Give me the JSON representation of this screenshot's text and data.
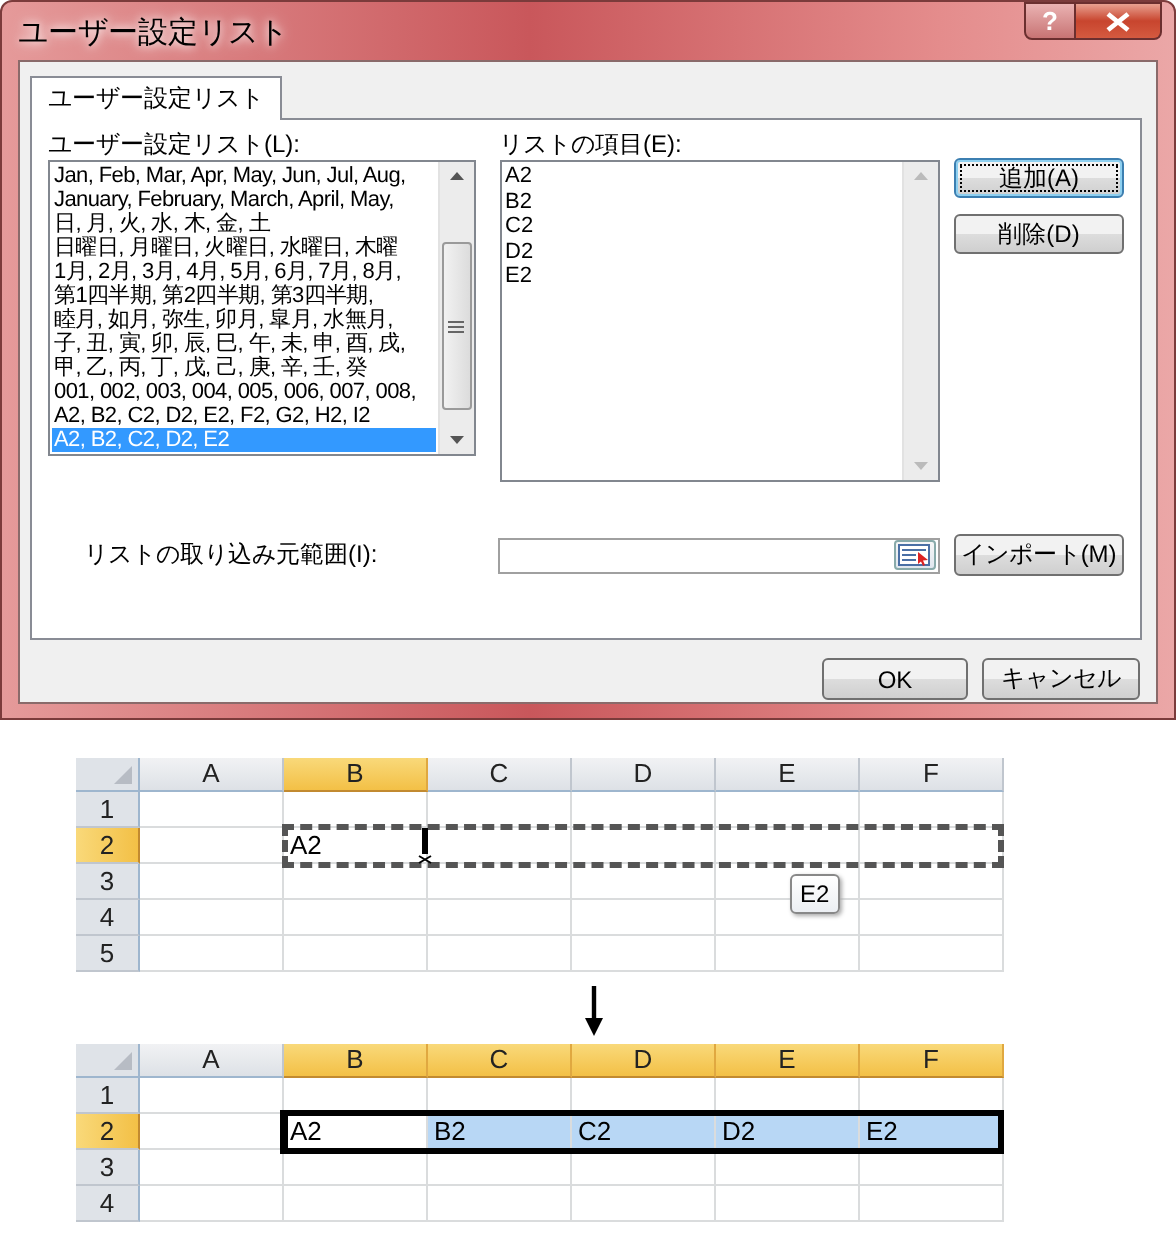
{
  "dialog": {
    "title": "ユーザー設定リスト",
    "help_button": "?",
    "tabs": [
      {
        "label": "ユーザー設定リスト",
        "selected": true
      }
    ],
    "custom_lists": {
      "label": "ユーザー設定リスト(L):",
      "items": [
        {
          "text": "Jan, Feb, Mar, Apr, May, Jun, Jul, Aug,",
          "selected": false
        },
        {
          "text": "January, February, March, April, May,",
          "selected": false
        },
        {
          "text": "日, 月, 火, 水, 木, 金, 土",
          "selected": false
        },
        {
          "text": "日曜日, 月曜日, 火曜日, 水曜日, 木曜",
          "selected": false
        },
        {
          "text": "1月, 2月, 3月, 4月, 5月, 6月, 7月, 8月,",
          "selected": false
        },
        {
          "text": "第1四半期, 第2四半期, 第3四半期,",
          "selected": false
        },
        {
          "text": "睦月, 如月, 弥生, 卯月, 皐月, 水無月,",
          "selected": false
        },
        {
          "text": "子, 丑, 寅, 卯, 辰, 巳, 午, 未, 申, 酉, 戌,",
          "selected": false
        },
        {
          "text": "甲, 乙, 丙, 丁, 戊, 己, 庚, 辛, 壬, 癸",
          "selected": false
        },
        {
          "text": "001, 002, 003, 004, 005, 006, 007, 008,",
          "selected": false
        },
        {
          "text": "A2, B2, C2, D2, E2, F2, G2, H2, I2",
          "selected": false
        },
        {
          "text": "A2, B2, C2, D2, E2",
          "selected": true
        }
      ]
    },
    "list_entries": {
      "label": "リストの項目(E):",
      "items": [
        "A2",
        "B2",
        "C2",
        "D2",
        "E2"
      ]
    },
    "side_buttons": [
      {
        "label": "追加(A)",
        "default": true
      },
      {
        "label": "削除(D)",
        "default": false
      }
    ],
    "import": {
      "label": "リストの取り込み元範囲(I):",
      "button": "インポート(M)"
    },
    "footer_buttons": [
      "OK",
      "キャンセル"
    ]
  },
  "sheets": [
    {
      "columns": [
        {
          "label": "A",
          "selected": false
        },
        {
          "label": "B",
          "selected": true
        },
        {
          "label": "C",
          "selected": false
        },
        {
          "label": "D",
          "selected": false
        },
        {
          "label": "E",
          "selected": false
        },
        {
          "label": "F",
          "selected": false
        }
      ],
      "rows": [
        {
          "label": "1",
          "selected": false
        },
        {
          "label": "2",
          "selected": true,
          "cells": [
            {
              "copied": false
            },
            {
              "text": "A2",
              "copied": true
            },
            {
              "copied": true
            },
            {
              "copied": true
            },
            {
              "copied": true
            },
            {
              "copied": true
            }
          ]
        },
        {
          "label": "3",
          "selected": false
        },
        {
          "label": "4",
          "selected": false
        },
        {
          "label": "5",
          "selected": false
        }
      ],
      "drag_tooltip": "E2"
    },
    {
      "columns": [
        {
          "label": "A",
          "selected": false
        },
        {
          "label": "B",
          "selected": true
        },
        {
          "label": "C",
          "selected": true
        },
        {
          "label": "D",
          "selected": true
        },
        {
          "label": "E",
          "selected": true
        },
        {
          "label": "F",
          "selected": true
        }
      ],
      "rows": [
        {
          "label": "1",
          "selected": false
        },
        {
          "label": "2",
          "selected": true,
          "cells": [
            {
              "selected": false,
              "active": false
            },
            {
              "text": "A2",
              "selected": true,
              "active": true
            },
            {
              "text": "B2",
              "selected": true,
              "active": false
            },
            {
              "text": "C2",
              "selected": true,
              "active": false
            },
            {
              "text": "D2",
              "selected": true,
              "active": false
            },
            {
              "text": "E2",
              "selected": true,
              "active": false
            }
          ]
        },
        {
          "label": "3",
          "selected": false
        },
        {
          "label": "4",
          "selected": false
        }
      ]
    }
  ]
}
